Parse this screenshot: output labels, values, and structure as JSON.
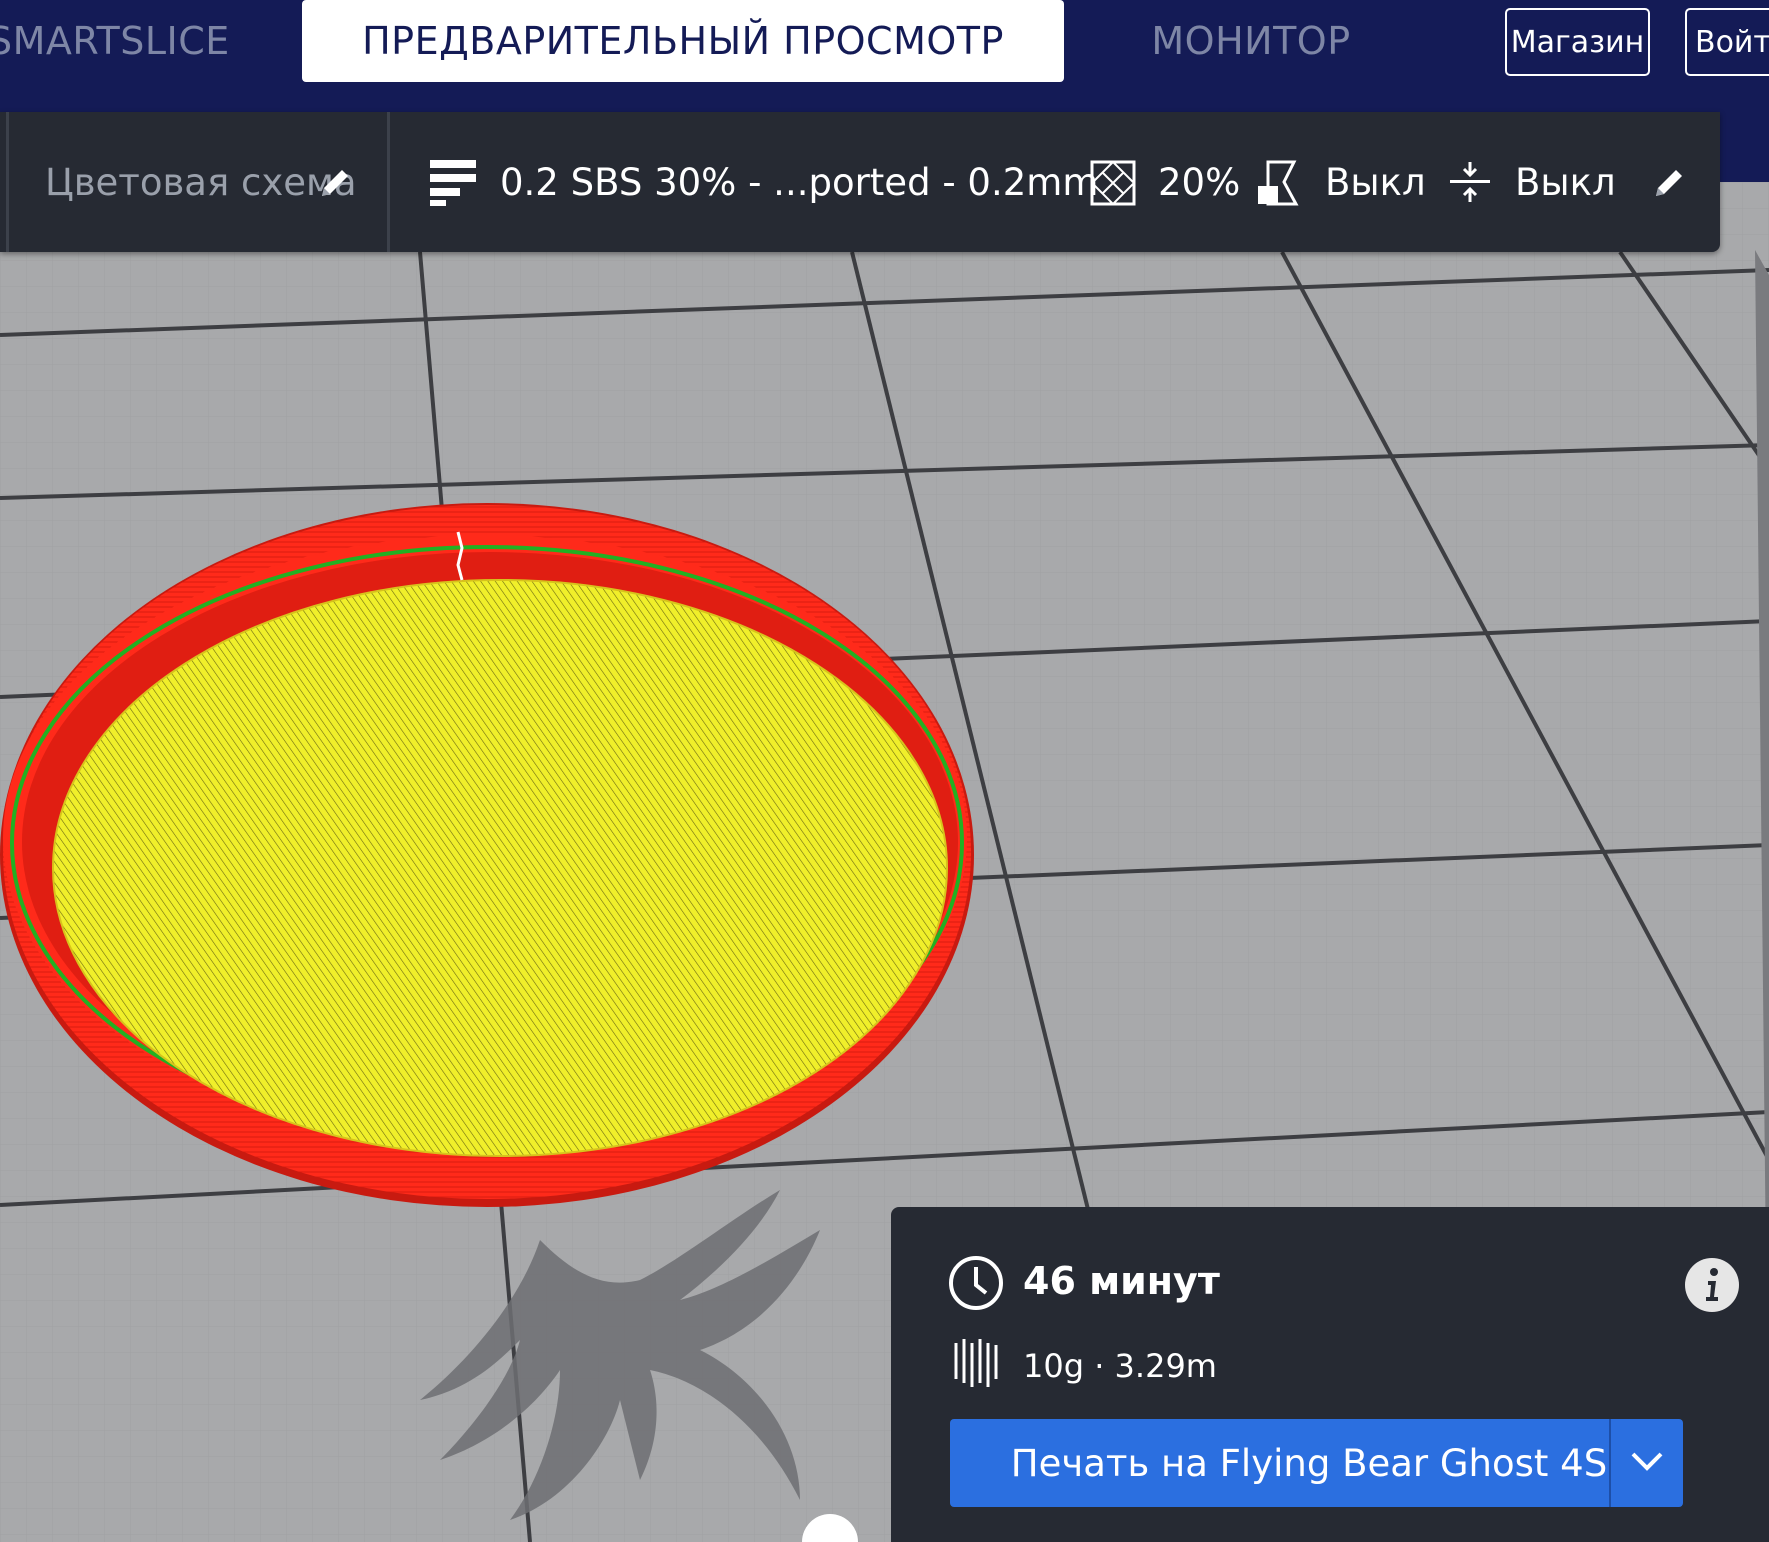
{
  "nav": {
    "tabs": [
      {
        "label": "SMARTSLICE"
      },
      {
        "label": "ПРЕДВАРИТЕЛЬНЫЙ ПРОСМОТР"
      },
      {
        "label": "МОНИТОР"
      }
    ],
    "store_label": "Магазин",
    "signin_label": "Войти"
  },
  "toolbar": {
    "color_scheme_label": "Цветовая схема",
    "profile_label": "0.2 SBS 30% - ...ported - 0.2mm",
    "infill_value": "20%",
    "support_value": "Выкл",
    "adhesion_value": "Выкл",
    "icons": [
      "pencil-icon",
      "profile-layers-icon",
      "infill-icon",
      "support-icon",
      "adhesion-icon",
      "pencil-icon"
    ]
  },
  "print_panel": {
    "time_label": "46 минут",
    "material_label": "10g · 3.29m",
    "print_button_label": "Печать на Flying Bear Ghost 4S",
    "icons": [
      "clock-icon",
      "info-icon",
      "filament-icon",
      "chevron-down-icon"
    ]
  },
  "colors": {
    "header_bg": "#141b56",
    "toolbar_bg": "#262a33",
    "accent_blue": "#2b6fe0",
    "wall_red": "#ff2a1a",
    "infill_yellow": "#f0ef2a",
    "outer_green": "#22b022",
    "build_plate": "#a8a9ab"
  }
}
